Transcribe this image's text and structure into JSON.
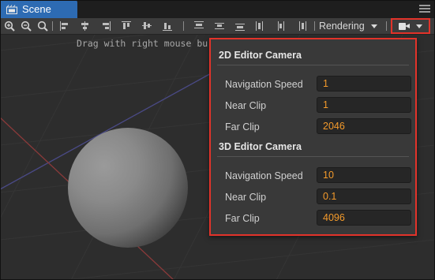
{
  "tab": {
    "title": "Scene",
    "icon": "scene-tab-icon"
  },
  "toolbar": {
    "render_mode": "Rendering",
    "icons": [
      "zoom-in-icon",
      "zoom-out-icon",
      "zoom-reset-icon"
    ],
    "align_icons": [
      "align-left-icon",
      "align-hcenter-icon",
      "align-right-icon",
      "align-top-icon",
      "align-vcenter-icon",
      "align-bottom-icon",
      "distribute-top-icon",
      "distribute-vcenter-icon",
      "distribute-bottom-icon",
      "distribute-left-icon",
      "distribute-hcenter-icon",
      "distribute-right-icon"
    ]
  },
  "viewport": {
    "hint": "Drag with right mouse bu"
  },
  "camera_panel": {
    "section_2d": {
      "title": "2D Editor Camera",
      "rows": [
        {
          "label": "Navigation Speed",
          "value": "1"
        },
        {
          "label": "Near Clip",
          "value": "1"
        },
        {
          "label": "Far Clip",
          "value": "2046"
        }
      ]
    },
    "section_3d": {
      "title": "3D Editor Camera",
      "rows": [
        {
          "label": "Navigation Speed",
          "value": "10"
        },
        {
          "label": "Near Clip",
          "value": "0.1"
        },
        {
          "label": "Far Clip",
          "value": "4096"
        }
      ]
    }
  },
  "colors": {
    "accent": "#2d6bb3",
    "highlight": "#e2332a",
    "value_text": "#f39a2b"
  }
}
